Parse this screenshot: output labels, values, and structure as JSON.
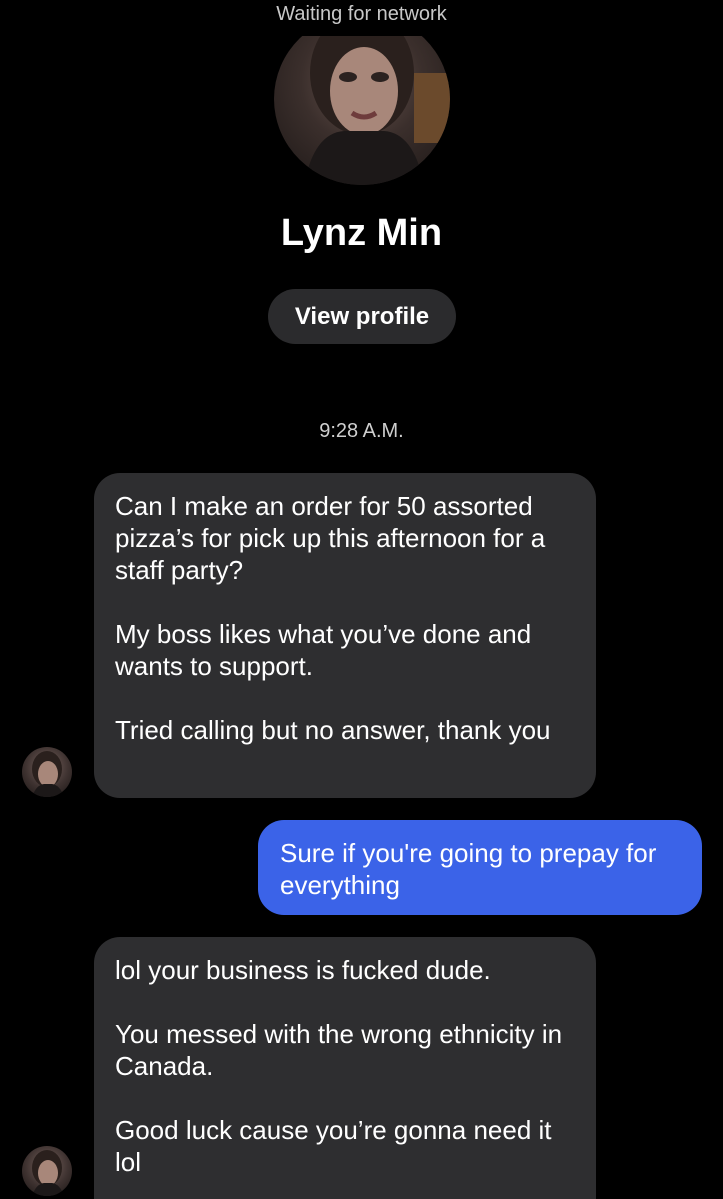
{
  "status_bar": {
    "network_status": "Waiting for network"
  },
  "contact": {
    "name": "Lynz Min",
    "view_profile_label": "View profile",
    "avatar_icon": "profile-photo"
  },
  "thread": {
    "timestamp": "9:28 A.M.",
    "messages": [
      {
        "direction": "incoming",
        "paragraphs": [
          "Can I make an order for 50 assorted pizza’s for pick up this afternoon for a staff party?",
          "My boss likes what you’ve done and wants to support.",
          "Tried calling but no answer, thank you"
        ]
      },
      {
        "direction": "outgoing",
        "paragraphs": [
          "Sure if you're going to prepay for everything"
        ]
      },
      {
        "direction": "incoming",
        "paragraphs": [
          "lol your business is fucked dude.",
          "You messed with the wrong ethnicity in Canada.",
          "Good luck cause you’re gonna need it lol"
        ]
      }
    ]
  },
  "colors": {
    "background": "#000000",
    "incoming_bubble": "#2e2e30",
    "outgoing_bubble": "#3b63e8",
    "button_background": "#2b2b2d"
  }
}
